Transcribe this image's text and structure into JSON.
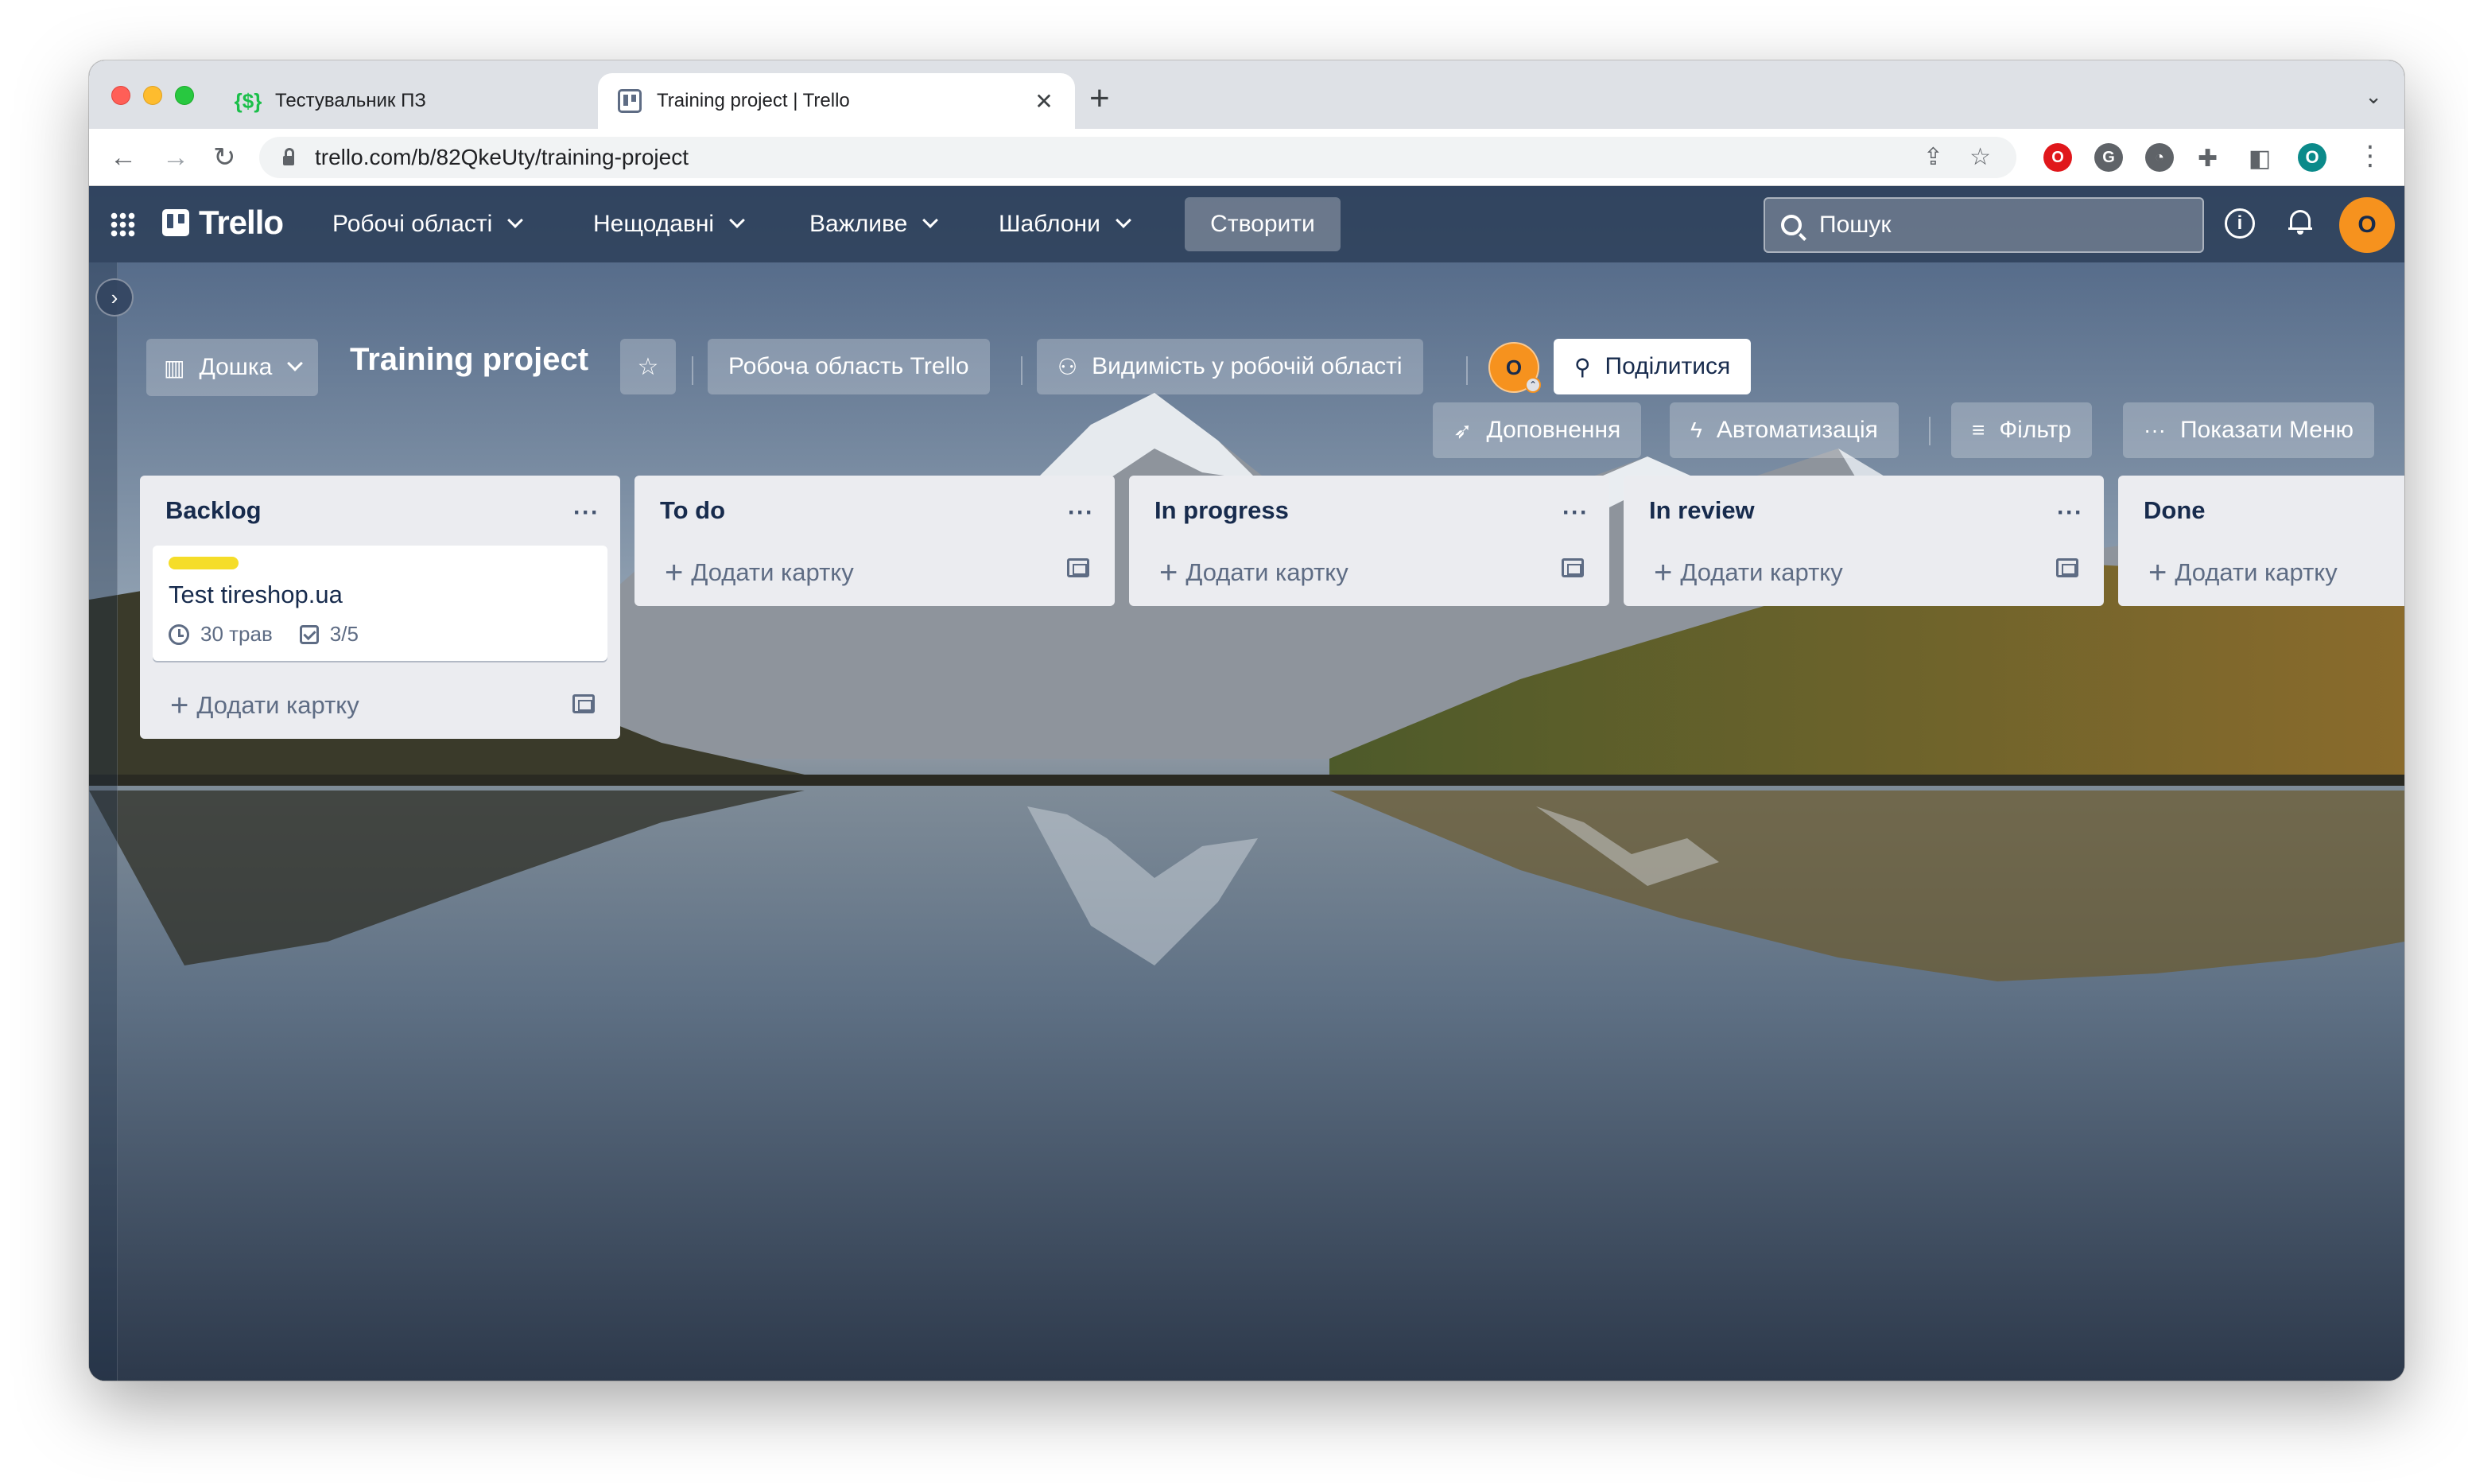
{
  "browser": {
    "tabs": [
      {
        "title": "Тестувальник ПЗ",
        "favicon": "money-icon",
        "active": false
      },
      {
        "title": "Training project | Trello",
        "favicon": "trello-icon",
        "active": true
      }
    ],
    "new_tab_symbol": "+",
    "url": "trello.com/b/82QkeUty/training-project",
    "profile_initial": "O"
  },
  "topnav": {
    "logo": "Trello",
    "menus": [
      "Робочі області",
      "Нещодавні",
      "Важливе",
      "Шаблони"
    ],
    "create_label": "Створити",
    "search_placeholder": "Пошук",
    "avatar_initial": "O"
  },
  "board": {
    "view_label": "Дошка",
    "title": "Training project",
    "workspace_label": "Робоча область Trello",
    "visibility_label": "Видимість у робочій області",
    "member_initial": "O",
    "share_label": "Поділитися",
    "powerups_label": "Доповнення",
    "automation_label": "Автоматизація",
    "filter_label": "Фільтр",
    "menu_label": "Показати Меню"
  },
  "lists": [
    {
      "title": "Backlog",
      "add_card_label": "Додати картку",
      "cards": [
        {
          "title": "Test tireshop.ua",
          "label_color": "#f5dd29",
          "due": "30 трав",
          "checklist": "3/5"
        }
      ]
    },
    {
      "title": "To do",
      "add_card_label": "Додати картку",
      "cards": []
    },
    {
      "title": "In progress",
      "add_card_label": "Додати картку",
      "cards": []
    },
    {
      "title": "In review",
      "add_card_label": "Додати картку",
      "cards": []
    },
    {
      "title": "Done",
      "add_card_label": "Додати картку",
      "cards": []
    }
  ],
  "colors": {
    "nav_bg": "#2c3e58",
    "list_bg": "#ebecf0",
    "avatar_orange": "#f6921e",
    "label_yellow": "#f5dd29"
  }
}
